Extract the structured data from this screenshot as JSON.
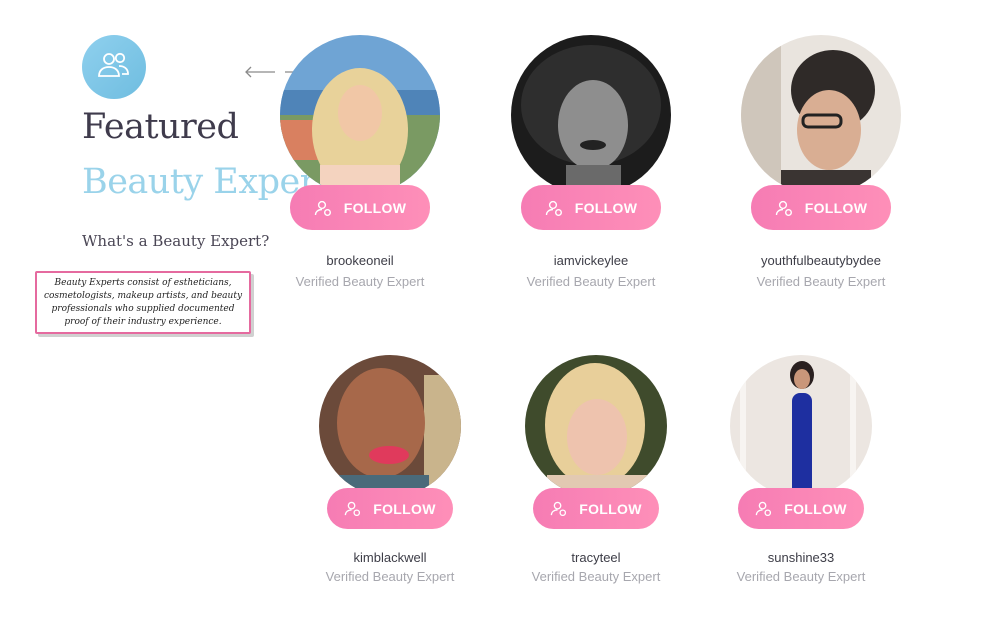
{
  "header": {
    "badge_icon": "users-icon",
    "title_line1": "Featured",
    "title_line2": "Beauty Expert",
    "arrows": [
      "arrow-left-icon",
      "arrow-right-icon"
    ]
  },
  "info": {
    "heading": "What's a Beauty Expert?",
    "description": "Beauty Experts consist of estheticians, cosmetologists, makeup artists, and beauty professionals who supplied documented proof of their industry experience."
  },
  "experts": [
    {
      "username": "brookeoneil",
      "role": "Verified Beauty Expert",
      "follow_label": "FOLLOW"
    },
    {
      "username": "iamvickeylee",
      "role": "Verified Beauty Expert",
      "follow_label": "FOLLOW"
    },
    {
      "username": "youthfulbeautybydee",
      "role": "Verified Beauty Expert",
      "follow_label": "FOLLOW"
    },
    {
      "username": "kimblackwell",
      "role": "Verified Beauty Expert",
      "follow_label": "FOLLOW"
    },
    {
      "username": "tracyteel",
      "role": "Verified Beauty Expert",
      "follow_label": "FOLLOW"
    },
    {
      "username": "sunshine33",
      "role": "Verified Beauty Expert",
      "follow_label": "FOLLOW"
    }
  ],
  "colors": {
    "accent_pink": "#f67cb4",
    "badge_blue": "#7ec8e8",
    "title_dark": "#3f3b4c",
    "title_light": "#9ad3ea"
  }
}
